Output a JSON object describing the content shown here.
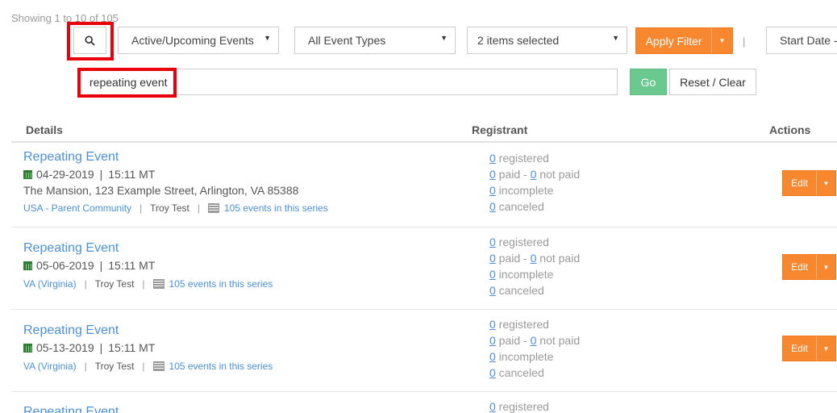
{
  "pagination": {
    "showing_text": "Showing 1 to 10 of 105"
  },
  "filters": {
    "search_icon": "search-icon",
    "status_select": "Active/Upcoming Events",
    "type_select": "All Event Types",
    "multi_select": "2 items selected",
    "apply_label": "Apply Filter",
    "separator": "|",
    "sort_select": "Start Date -",
    "search_value": "repeating event",
    "go_label": "Go",
    "reset_label": "Reset / Clear"
  },
  "table": {
    "headers": {
      "details": "Details",
      "registrant": "Registrant",
      "actions": "Actions"
    },
    "rows": [
      {
        "title": "Repeating Event",
        "date": "04-29-2019",
        "time": "15:11 MT",
        "address": "The Mansion, 123 Example Street, Arlington, VA 85388",
        "community": "USA - Parent Community",
        "owner": "Troy Test",
        "series": "105 events in this series",
        "registered": "0",
        "registered_label": " registered",
        "paid": "0",
        "paid_label": " paid - ",
        "not_paid": "0",
        "not_paid_label": " not paid",
        "incomplete": "0",
        "incomplete_label": " incomplete",
        "canceled": "0",
        "canceled_label": " canceled",
        "edit_label": "Edit"
      },
      {
        "title": "Repeating Event",
        "date": "05-06-2019",
        "time": "15:11 MT",
        "community": "VA (Virginia)",
        "owner": "Troy Test",
        "series": "105 events in this series",
        "registered": "0",
        "registered_label": " registered",
        "paid": "0",
        "paid_label": " paid - ",
        "not_paid": "0",
        "not_paid_label": " not paid",
        "incomplete": "0",
        "incomplete_label": " incomplete",
        "canceled": "0",
        "canceled_label": " canceled",
        "edit_label": "Edit"
      },
      {
        "title": "Repeating Event",
        "date": "05-13-2019",
        "time": "15:11 MT",
        "community": "VA (Virginia)",
        "owner": "Troy Test",
        "series": "105 events in this series",
        "registered": "0",
        "registered_label": " registered",
        "paid": "0",
        "paid_label": " paid - ",
        "not_paid": "0",
        "not_paid_label": " not paid",
        "incomplete": "0",
        "incomplete_label": " incomplete",
        "canceled": "0",
        "canceled_label": " canceled",
        "edit_label": "Edit"
      },
      {
        "title": "Repeating Event",
        "registered": "0",
        "registered_label": " registered"
      }
    ]
  },
  "colors": {
    "accent_orange": "#f8882f",
    "go_green": "#6bc98f",
    "link_blue": "#4a90d9",
    "highlight_red": "#e8000b"
  }
}
